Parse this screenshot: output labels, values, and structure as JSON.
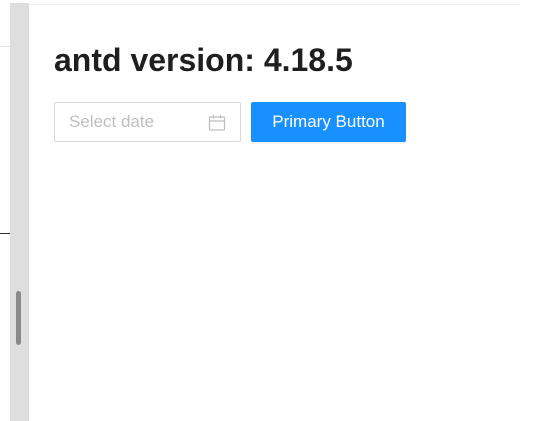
{
  "page": {
    "title": "antd version: 4.18.5"
  },
  "date_picker": {
    "placeholder": "Select date",
    "icon": "calendar-icon"
  },
  "primary_button": {
    "label": "Primary Button",
    "color": "#1890ff"
  }
}
